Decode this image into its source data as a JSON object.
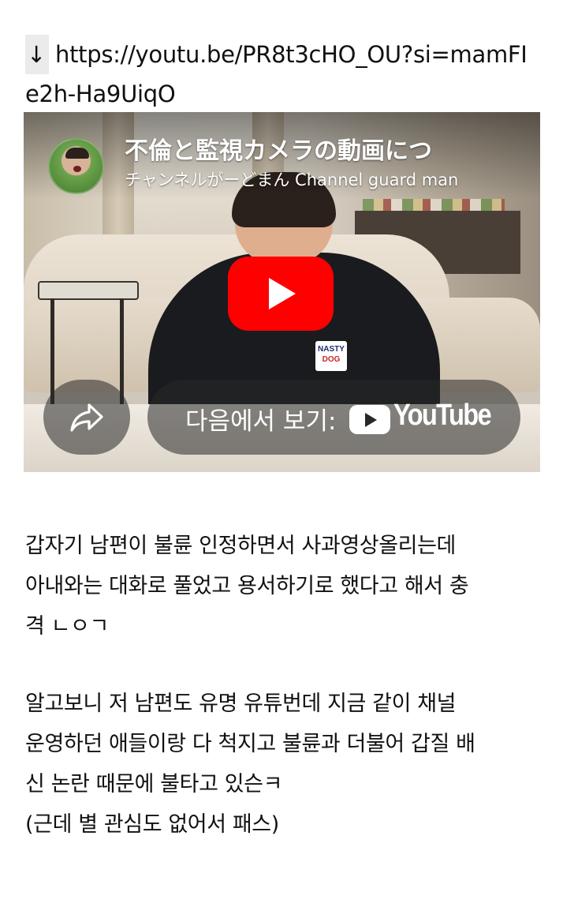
{
  "link": {
    "arrow": "↓",
    "url_line1": "https://youtu.be/PR8t3cHO_OU?si=mamFI",
    "url_line2": "e2h-Ha9UiqO"
  },
  "video": {
    "title": "不倫と監視カメラの動画につ",
    "channel": "チャンネルがーどまん Channel guard man",
    "watch_on_label": "다음에서 보기:",
    "youtube_wordmark": "YouTube",
    "shirt_text": [
      "NASTY",
      "DOG"
    ],
    "play_icon": "play-icon",
    "share_icon": "share-arrow-icon",
    "accent_color": "#ff0000"
  },
  "post": {
    "paragraph1": [
      "갑자기 남편이 불륜 인정하면서 사과영상올리는데",
      "아내와는 대화로 풀었고 용서하기로 했다고 해서 충",
      "격 ㄴㅇㄱ"
    ],
    "paragraph2": [
      "알고보니 저 남편도 유명 유튜번데 지금 같이 채널",
      "운영하던 애들이랑 다 척지고 불륜과 더불어 갑질 배",
      "신 논란 때문에 불타고 있슨ㅋ",
      "(근데 별 관심도 없어서 패스)"
    ]
  }
}
